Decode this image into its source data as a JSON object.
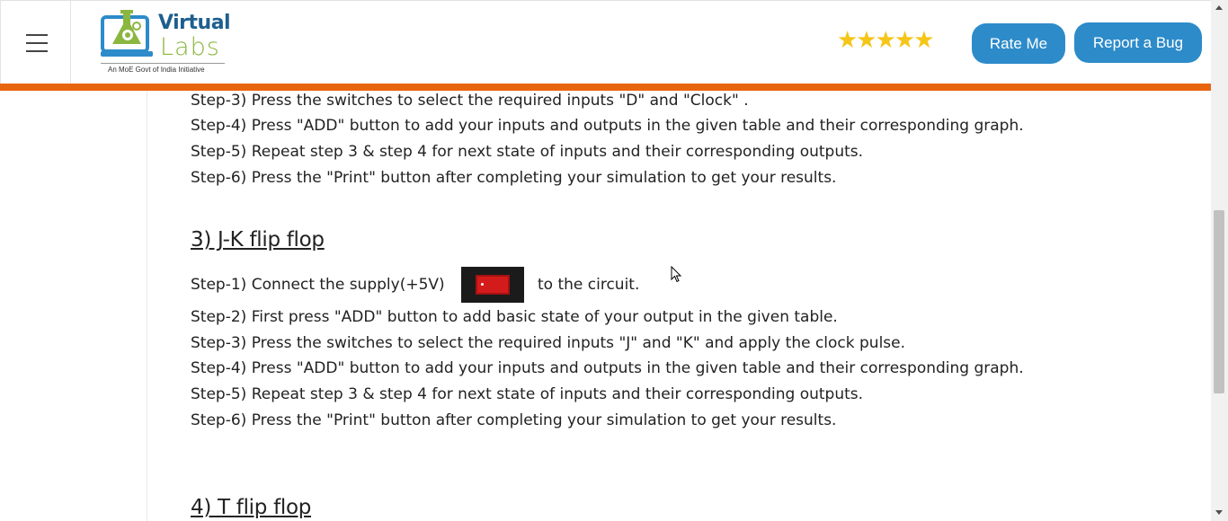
{
  "header": {
    "menu_icon": "hamburger-icon",
    "logo": {
      "word1": "Virtual",
      "word2": "Labs",
      "tagline": "An MoE Govt of India Initiative"
    },
    "rating_stars": 5,
    "rating_glyphs": "★★★★★",
    "rate_label": "Rate Me",
    "bug_label": "Report a Bug",
    "accent_color": "#e8650f",
    "button_color": "#2d8bca"
  },
  "content": {
    "section2_steps": [
      "Step-3) Press the switches to select the required inputs \"D\" and \"Clock\" .",
      "Step-4) Press \"ADD\" button to add your inputs and outputs in the given table and their corresponding graph.",
      "Step-5) Repeat step 3 & step 4 for next state of inputs and their corresponding outputs.",
      "Step-6) Press the \"Print\" button after completing your simulation to get your results."
    ],
    "jk_heading": "3) J-K flip flop",
    "jk_step1_before": "Step-1) Connect the supply(+5V)",
    "jk_step1_after": "to the circuit.",
    "jk_steps": [
      "Step-2) First press \"ADD\" button to add basic state of your output in the given table.",
      "Step-3) Press the switches to select the required inputs \"J\" and \"K\" and apply the clock pulse.",
      "Step-4) Press \"ADD\" button to add your inputs and outputs in the given table and their corresponding graph.",
      "Step-5) Repeat step 3 & step 4 for next state of inputs and their corresponding outputs.",
      "Step-6) Press the \"Print\" button after completing your simulation to get your results."
    ],
    "t_heading": "4) T flip flop"
  }
}
